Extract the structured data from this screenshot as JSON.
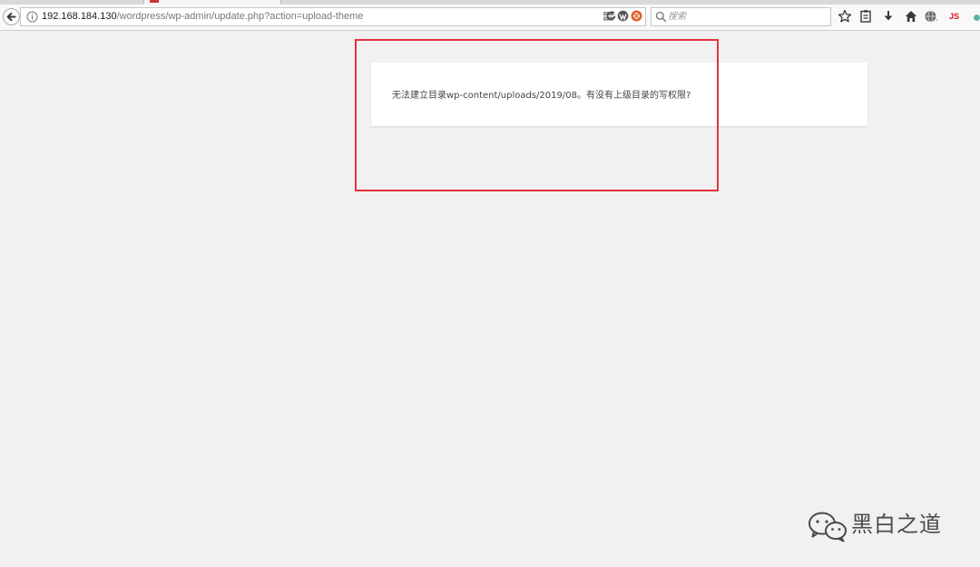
{
  "browser": {
    "url_host": "192.168.184.130",
    "url_path": "/wordpress/wp-admin/update.php?action=upload-theme",
    "search_placeholder": "搜索",
    "js_badge": "JS"
  },
  "icons": {
    "back": "back-arrow-icon",
    "info": "info-icon",
    "server": "server-icon",
    "wordpress": "wordpress-icon",
    "dropdown": "chevron-down-icon",
    "reload": "reload-icon",
    "extension": "extension-icon",
    "search": "search-icon",
    "bookmark": "star-icon",
    "reader": "clipboard-icon",
    "download": "download-icon",
    "home": "home-icon",
    "globe": "globe-icon"
  },
  "notice": {
    "message": "无法建立目录wp-content/uploads/2019/08。有没有上级目录的写权限?"
  },
  "watermark": {
    "text": "黑白之道"
  },
  "colors": {
    "page_background": "#f1f1f1",
    "highlight_box": "#e5323c",
    "notice_background": "#ffffff"
  }
}
